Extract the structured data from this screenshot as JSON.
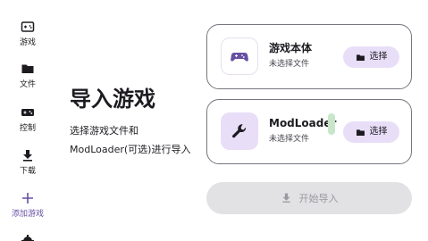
{
  "sidebar": {
    "items": [
      {
        "label": "游戏",
        "icon": "game-icon"
      },
      {
        "label": "文件",
        "icon": "folder-icon"
      },
      {
        "label": "控制",
        "icon": "controller-icon"
      },
      {
        "label": "下载",
        "icon": "download-icon"
      },
      {
        "label": "添加游戏",
        "icon": "add-icon"
      }
    ]
  },
  "main": {
    "title": "导入游戏",
    "description_line1": "选择游戏文件和",
    "description_line2": "ModLoader(可选)进行导入"
  },
  "cards": [
    {
      "title": "游戏本体",
      "subtitle": "未选择文件",
      "button_label": "选择",
      "icon": "gamepad-icon"
    },
    {
      "title": "ModLoader",
      "subtitle": "未选择文件",
      "button_label": "选择",
      "icon": "wrench-icon"
    }
  ],
  "start_button": {
    "label": "开始导入",
    "icon": "download-icon",
    "enabled": false
  },
  "colors": {
    "accent": "#6750a4",
    "accent_container": "#e8def8",
    "disabled_bg": "#e2e2e4",
    "disabled_text": "#9a999f",
    "indicator": "#c8e6c9"
  }
}
